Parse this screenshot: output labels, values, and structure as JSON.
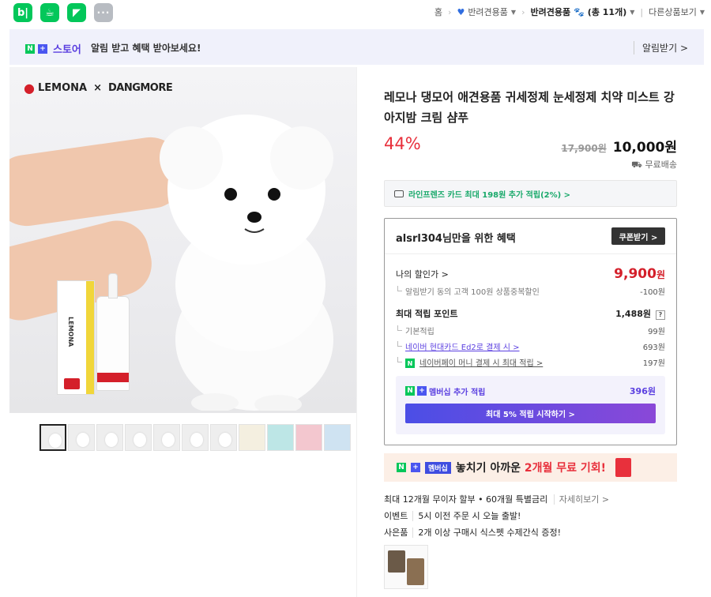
{
  "topbar": {
    "apps": [
      {
        "name": "blog",
        "glyph": "b|"
      },
      {
        "name": "cafe",
        "glyph": "☕"
      },
      {
        "name": "bookmark",
        "glyph": "◤"
      },
      {
        "name": "more",
        "glyph": "···"
      }
    ],
    "nav_home": "홈",
    "nav_category1": "반려견용품",
    "nav_category2": "반려견용품",
    "nav_count": "(총 11개)",
    "nav_more": "다른상품보기"
  },
  "notice": {
    "store_label": "스토어",
    "message": "알림 받고 혜택 받아보세요!",
    "action": "알림받기 >"
  },
  "brand": {
    "lemona": "LEMONA",
    "x": "×",
    "dangmore": "DANGMORE"
  },
  "product": {
    "title": "레모나 댕모어 애견용품 귀세정제 눈세정제 치약 미스트 강아지밤 크림 샴푸",
    "discount": "44%",
    "original_price": "17,900원",
    "sale_price": "10,000원",
    "shipping": "무료배송"
  },
  "card_bar": "라인프렌즈 카드 최대 198원 추가 적립(2%) >",
  "benefit": {
    "title": "alsrl304님만을 위한 혜택",
    "coupon_btn": "쿠폰받기 >",
    "my_price_label": "나의 할인가 >",
    "my_price": "9,900",
    "my_price_unit": "원",
    "discount_note": "알림받기 동의 고객 100원 상품중복할인",
    "discount_note_val": "-100원",
    "points_label": "최대 적립 포인트",
    "points_total": "1,488원",
    "points_q": "?",
    "basic_label": "기본적립",
    "basic_val": "99원",
    "card_label": "네이버 현대카드 Ed2로 결제 시 >",
    "card_val": "693원",
    "npay_label": "네이버페이 머니 결제 시 최대 적립 >",
    "npay_val": "197원",
    "member_label": "멤버십 추가 적립",
    "member_val": "396원",
    "member_btn": "최대 5% 적립 시작하기 >"
  },
  "promo": {
    "tag": "멤버십",
    "text_a": "놓치기 아까운 ",
    "text_hl": "2개월 무료 기회!"
  },
  "info": {
    "installment": "최대 12개월 무이자 할부 • 60개월 특별금리",
    "installment_more": "자세히보기 >",
    "event_tag": "이벤트",
    "event_text": "5시 이전 주문 시 오늘 출발!",
    "gift_tag": "사은품",
    "gift_text": "2개 이상 구매시 식스펫 수제간식 증정!"
  },
  "colors": {
    "naver_green": "#03c75a",
    "discount_red": "#e8303c",
    "member_purple": "#5a3fe0"
  }
}
